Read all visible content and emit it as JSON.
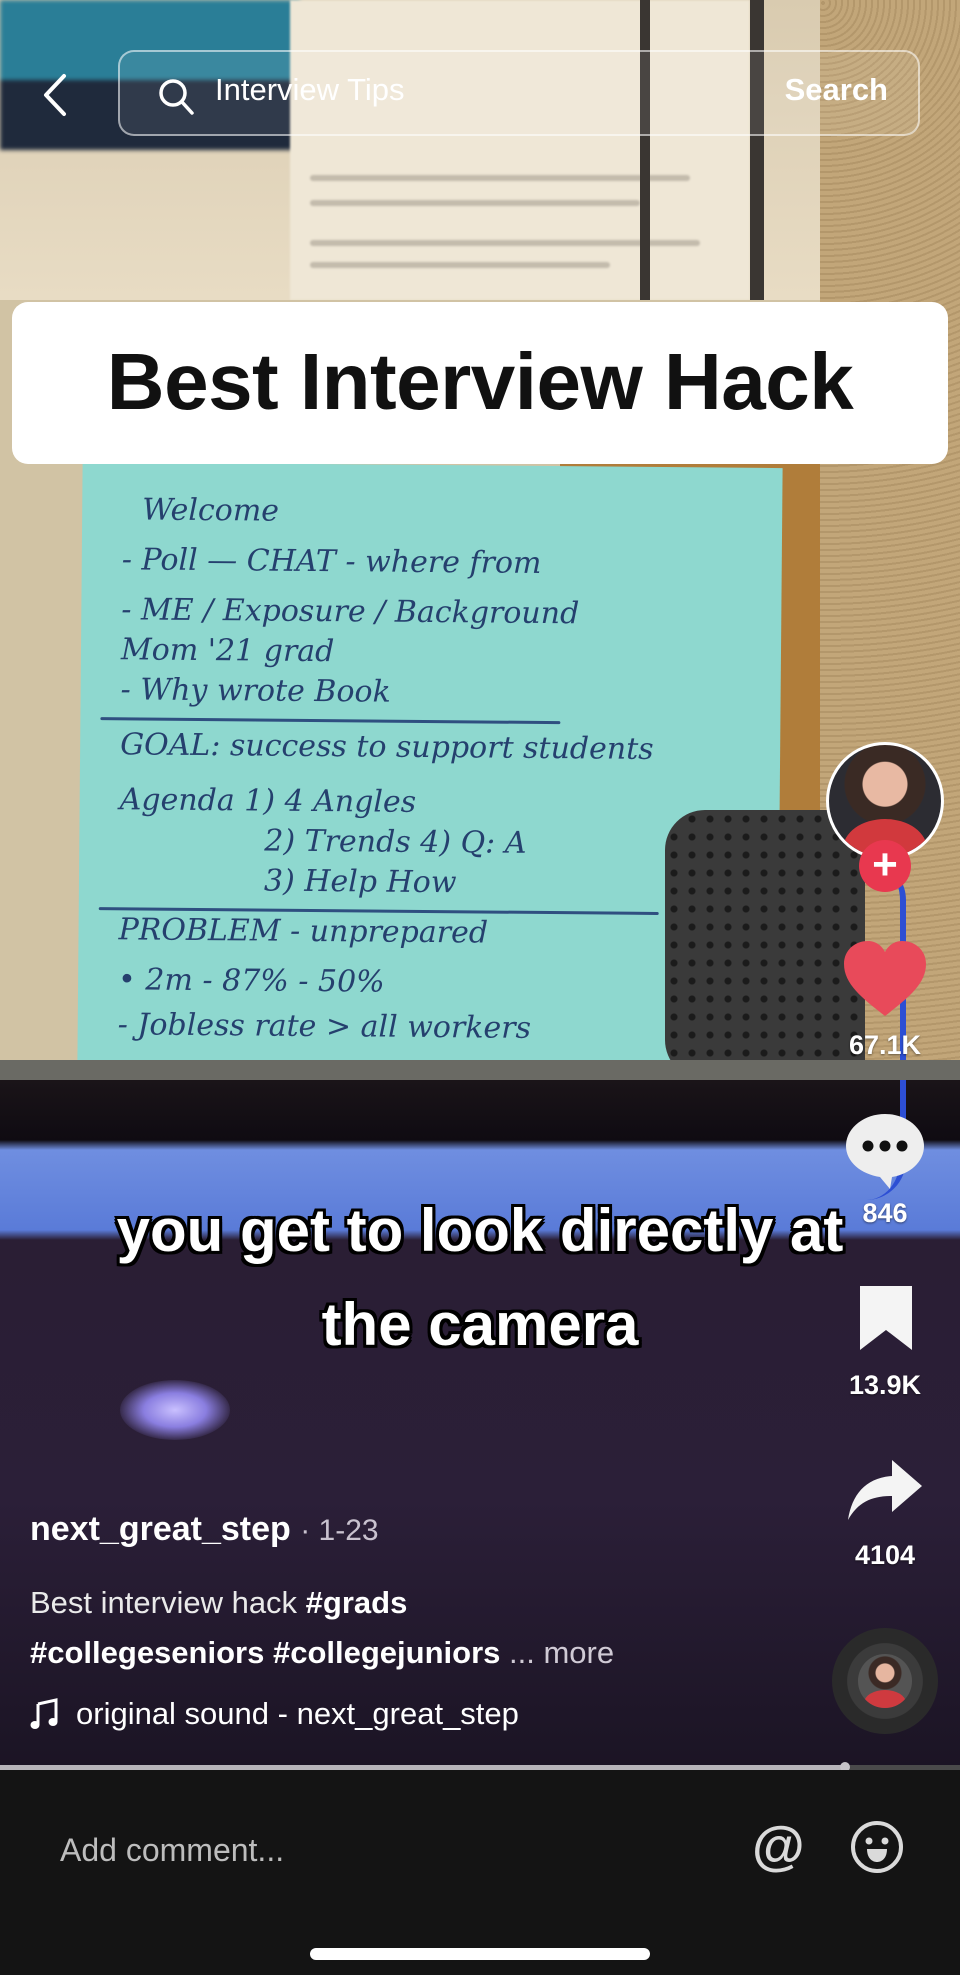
{
  "app": {
    "name": "TikTok video view"
  },
  "search": {
    "query": "Interview Tips",
    "button_label": "Search"
  },
  "video": {
    "title_overlay": "Best Interview Hack",
    "caption_line1": "you get to look directly at",
    "caption_line2": "the camera",
    "note_lines": [
      "Welcome",
      "- Poll — CHAT - where from",
      "- ME / Exposure / Background",
      "  Mom '21 grad",
      "- Why wrote Book",
      "GOAL: success to support students",
      "Agenda 1) 4 Angles",
      "2) Trends        4) Q: A",
      "3) Help How",
      "PROBLEM - unprepared",
      "• 2m - 87% - 50%",
      "- Jobless rate > all workers"
    ],
    "progress_fraction": 0.88
  },
  "rail": {
    "likes": "67.1K",
    "comments": "846",
    "saves": "13.9K",
    "shares": "4104",
    "follow_label": "+"
  },
  "post": {
    "username": "next_great_step",
    "date": "· 1-23",
    "description_text": "Best interview hack ",
    "hashtags": [
      "#grads",
      "#collegeseniors",
      "#collegejuniors"
    ],
    "more_label": "... more",
    "sound": "original sound - next_great_step"
  },
  "comment": {
    "placeholder": "Add comment...",
    "mention_label": "@"
  },
  "colors": {
    "accent_red": "#e8384f",
    "like_red": "#e84a5a",
    "background": "#141414"
  }
}
